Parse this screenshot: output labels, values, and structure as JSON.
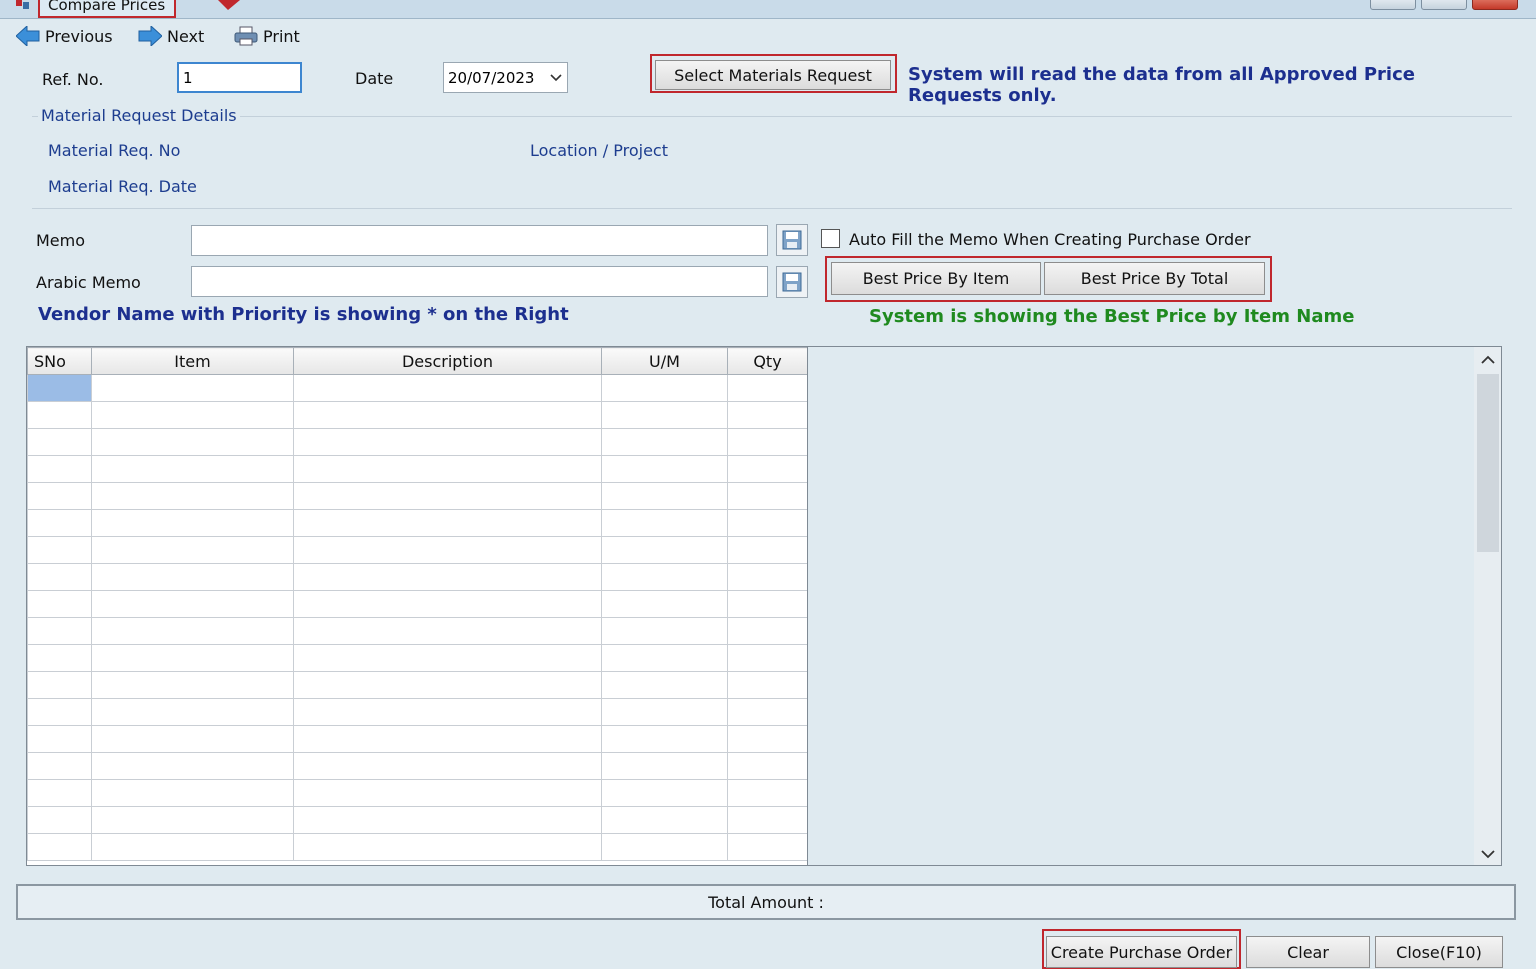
{
  "window": {
    "title": "Compare Prices"
  },
  "toolbar": {
    "previous": "Previous",
    "next": "Next",
    "print": "Print"
  },
  "form": {
    "ref_label": "Ref. No.",
    "ref_value": "1",
    "date_label": "Date",
    "date_value": "20/07/2023",
    "select_materials_button": "Select Materials Request",
    "approved_note": "System will read the data from all Approved Price Requests only."
  },
  "material_request": {
    "group_title": "Material Request Details",
    "req_no_label": "Material Req. No",
    "location_label": "Location / Project",
    "req_date_label": "Material Req. Date"
  },
  "memo": {
    "memo_label": "Memo",
    "arabic_memo_label": "Arabic Memo",
    "memo_value": "",
    "arabic_memo_value": "",
    "autofill_label": "Auto Fill the Memo When Creating Purchase Order",
    "autofill_checked": false
  },
  "best_price": {
    "by_item_button": "Best Price By Item",
    "by_total_button": "Best Price By Total",
    "status_note": "System is showing the Best Price by Item Name"
  },
  "vendor_note": "Vendor Name with Priority is showing * on the Right",
  "grid": {
    "columns": [
      "SNo",
      "Item",
      "Description",
      "U/M",
      "Qty"
    ]
  },
  "totals": {
    "label": "Total Amount :"
  },
  "footer": {
    "create_po_button": "Create Purchase Order",
    "clear_button": "Clear",
    "close_button": "Close(F10)"
  },
  "colors": {
    "note_blue": "#1c2f8f",
    "note_green": "#1f8a1f",
    "highlight_red": "#c0272d",
    "background": "#dfeaf0"
  }
}
